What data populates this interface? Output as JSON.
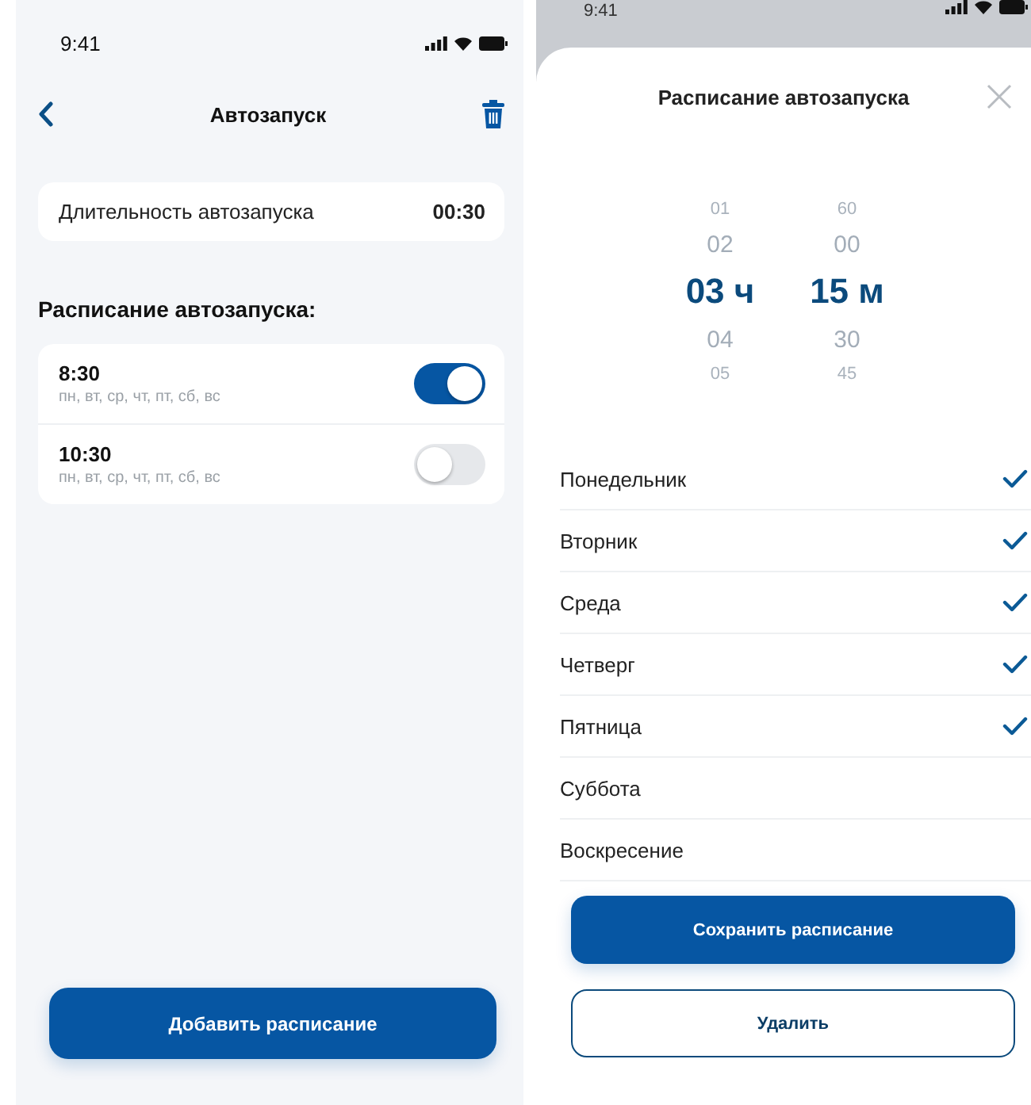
{
  "main_screen": {
    "status_bar": {
      "time": "9:41"
    },
    "title": "Автозапуск",
    "duration": {
      "label": "Длительность автозапуска",
      "value": "00:30"
    },
    "schedule_heading": "Расписание автозапуска:",
    "schedules": [
      {
        "time": "8:30",
        "days": "пн, вт, ср, чт, пт, сб, вс",
        "on": true
      },
      {
        "time": "10:30",
        "days": "пн, вт, ср, чт, пт, сб, вс",
        "on": false
      }
    ],
    "add_button": "Добавить расписание"
  },
  "sheet": {
    "status_bar": {
      "time": "9:41"
    },
    "title": "Расписание автозапуска",
    "picker": {
      "hours": [
        {
          "label": "01",
          "selected": false
        },
        {
          "label": "02",
          "selected": false
        },
        {
          "label": "03 ч",
          "selected": true
        },
        {
          "label": "04",
          "selected": false
        },
        {
          "label": "05",
          "selected": false
        }
      ],
      "minutes": [
        {
          "label": "60",
          "selected": false
        },
        {
          "label": "00",
          "selected": false
        },
        {
          "label": "15 м",
          "selected": true
        },
        {
          "label": "30",
          "selected": false
        },
        {
          "label": "45",
          "selected": false
        }
      ]
    },
    "days": [
      {
        "label": "Понедельник",
        "checked": true
      },
      {
        "label": "Вторник",
        "checked": true
      },
      {
        "label": "Среда",
        "checked": true
      },
      {
        "label": "Четверг",
        "checked": true
      },
      {
        "label": "Пятница",
        "checked": true
      },
      {
        "label": "Суббота",
        "checked": false
      },
      {
        "label": "Воскресение",
        "checked": false
      }
    ],
    "save_button": "Сохранить расписание",
    "delete_button": "Удалить"
  }
}
